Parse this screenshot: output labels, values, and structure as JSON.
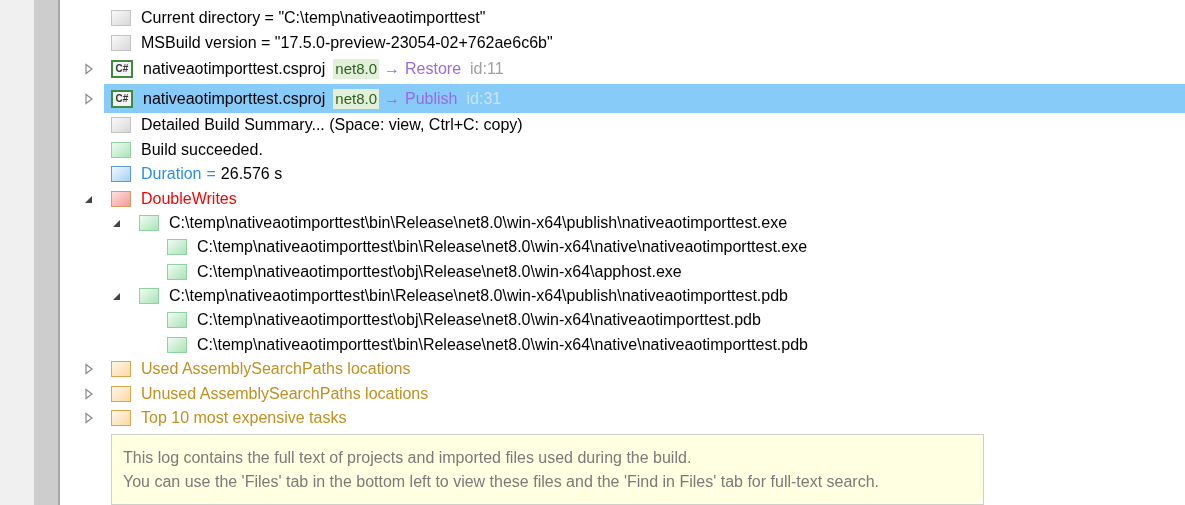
{
  "tree": [
    {
      "kind": "message",
      "text": "Current directory = \"C:\\temp\\nativeaotimporttest\""
    },
    {
      "kind": "message",
      "text": "MSBuild version = \"17.5.0-preview-23054-02+762ae6c6b\""
    },
    {
      "kind": "project",
      "icon_text": "C#",
      "name": "nativeaotimporttest.csproj",
      "framework": "net8.0",
      "arrow": "→",
      "target": "Restore",
      "id": "id:11",
      "expanded": false,
      "selected": false
    },
    {
      "kind": "project",
      "icon_text": "C#",
      "name": "nativeaotimporttest.csproj",
      "framework": "net8.0",
      "arrow": "→",
      "target": "Publish",
      "id": "id:31",
      "expanded": false,
      "selected": true
    },
    {
      "kind": "message",
      "text": "Detailed Build Summary... (Space: view, Ctrl+C: copy)"
    },
    {
      "kind": "success",
      "text": "Build succeeded."
    },
    {
      "kind": "property",
      "name": "Duration",
      "separator": "=",
      "value": "26.576 s"
    },
    {
      "kind": "error",
      "text": "DoubleWrites",
      "expanded": true,
      "children": [
        {
          "kind": "file",
          "text": "C:\\temp\\nativeaotimporttest\\bin\\Release\\net8.0\\win-x64\\publish\\nativeaotimporttest.exe",
          "expanded": true,
          "children": [
            {
              "kind": "file",
              "text": "C:\\temp\\nativeaotimporttest\\bin\\Release\\net8.0\\win-x64\\native\\nativeaotimporttest.exe"
            },
            {
              "kind": "file",
              "text": "C:\\temp\\nativeaotimporttest\\obj\\Release\\net8.0\\win-x64\\apphost.exe"
            }
          ]
        },
        {
          "kind": "file",
          "text": "C:\\temp\\nativeaotimporttest\\bin\\Release\\net8.0\\win-x64\\publish\\nativeaotimporttest.pdb",
          "expanded": true,
          "children": [
            {
              "kind": "file",
              "text": "C:\\temp\\nativeaotimporttest\\obj\\Release\\net8.0\\win-x64\\nativeaotimporttest.pdb"
            },
            {
              "kind": "file",
              "text": "C:\\temp\\nativeaotimporttest\\bin\\Release\\net8.0\\win-x64\\native\\nativeaotimporttest.pdb"
            }
          ]
        }
      ]
    },
    {
      "kind": "folder",
      "text": "Used AssemblySearchPaths locations",
      "expanded": false
    },
    {
      "kind": "folder",
      "text": "Unused AssemblySearchPaths locations",
      "expanded": false
    },
    {
      "kind": "folder",
      "text": "Top 10 most expensive tasks",
      "expanded": false
    }
  ],
  "note": [
    "This log contains the full text of projects and imported files used during the build.",
    "You can use the 'Files' tab in the bottom left to view these files and the 'Find in Files' tab for full-text search."
  ]
}
